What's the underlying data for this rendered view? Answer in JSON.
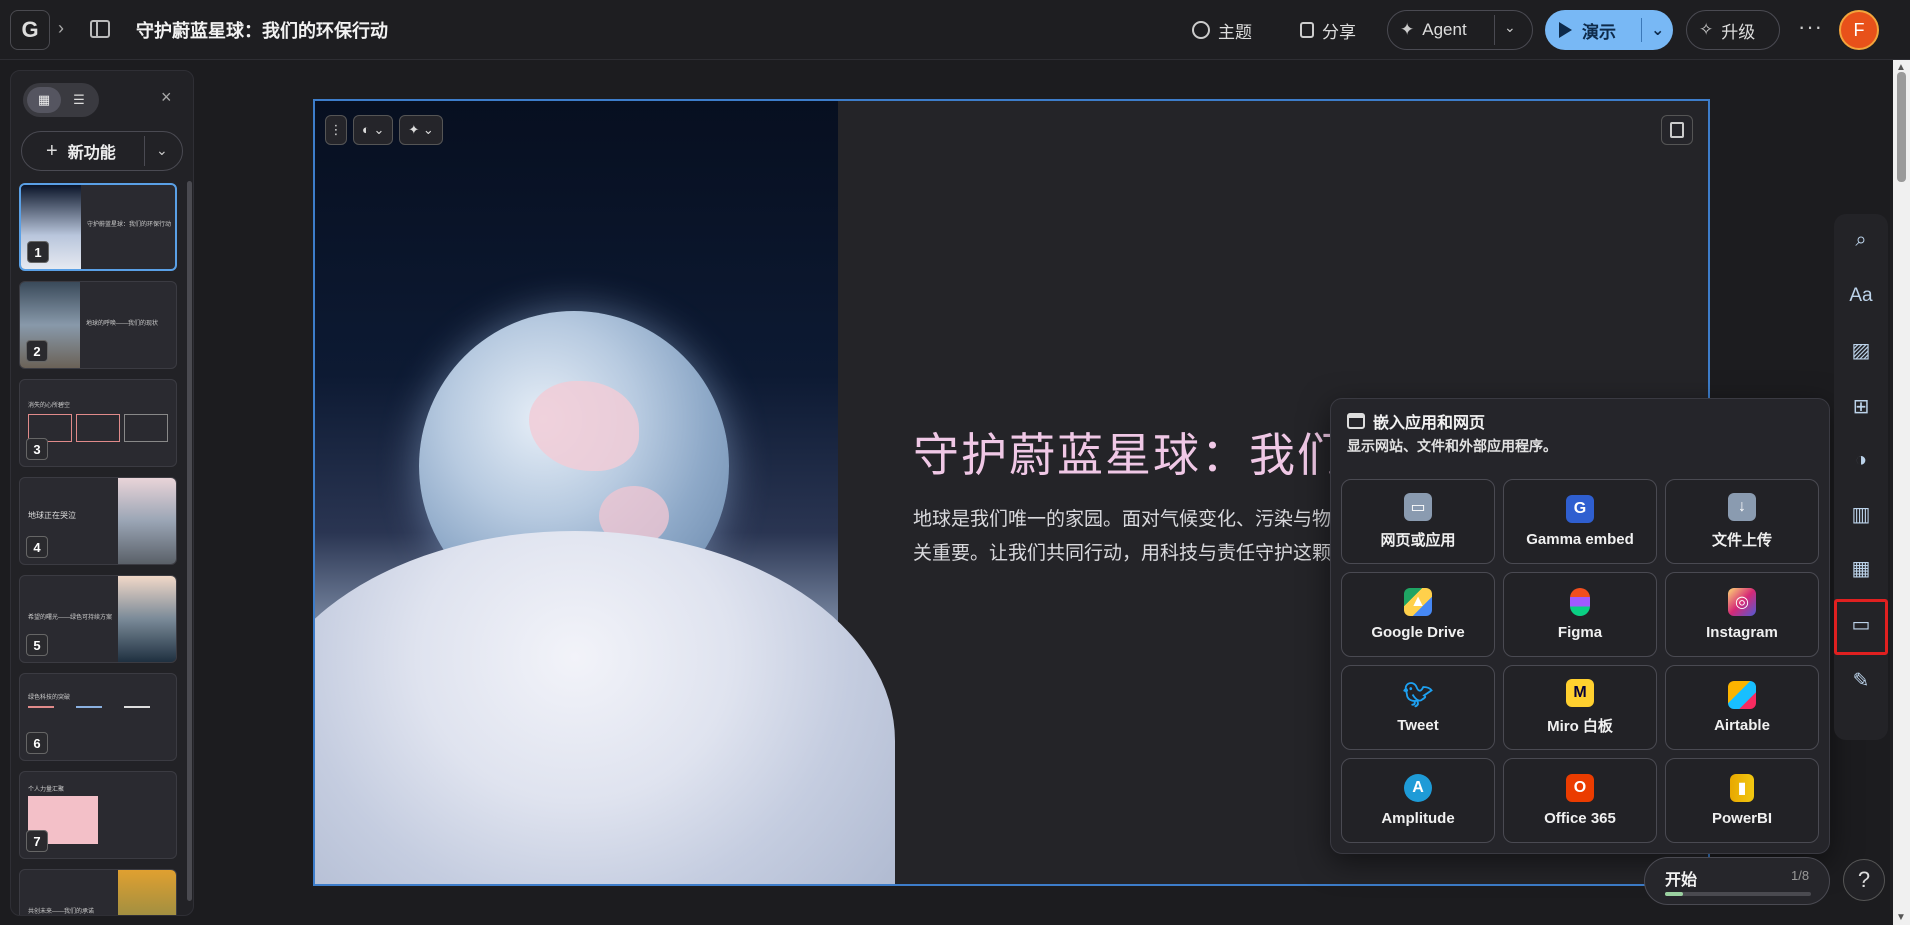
{
  "app": {
    "logo_letter": "G",
    "doc_title": "守护蔚蓝星球：我们的环保行动"
  },
  "toolbar": {
    "theme_label": "主题",
    "share_label": "分享",
    "agent_label": "Agent",
    "present_label": "演示",
    "upgrade_label": "升级",
    "more_label": "···",
    "avatar_letter": "F"
  },
  "left_panel": {
    "new_feature_label": "新功能",
    "close_label": "×",
    "thumbnails": [
      {
        "num": "1",
        "title": "守护蔚蓝星球：我们的环保行动"
      },
      {
        "num": "2",
        "title": "地球的呼唤——我们的现状"
      },
      {
        "num": "3",
        "title": "消失的心所碧空"
      },
      {
        "num": "4",
        "title": "地球正在哭泣"
      },
      {
        "num": "5",
        "title": "希望的曙光——绿色可持续方案"
      },
      {
        "num": "6",
        "title": "绿色科技的突破"
      },
      {
        "num": "7",
        "title": "个人力量汇聚"
      },
      {
        "num": "8",
        "title": "共创未来——我们的承诺"
      }
    ]
  },
  "slide": {
    "title_main": "守护蔚蓝星球：我们",
    "body": "地球是我们唯一的家园。面对气候变化、污染与物关重要。让我们共同行动，用科技与责任守护这颗"
  },
  "embed_popover": {
    "title": "嵌入应用和网页",
    "subtitle": "显示网站、文件和外部应用程序。",
    "items": [
      {
        "label": "网页或应用",
        "icon": "browser-window-icon",
        "color": "#8a9bb0"
      },
      {
        "label": "Gamma embed",
        "icon": "gamma-icon",
        "color": "#2f5fd0"
      },
      {
        "label": "文件上传",
        "icon": "file-upload-icon",
        "color": "#8a9bb0"
      },
      {
        "label": "Google Drive",
        "icon": "google-drive-icon",
        "color": "#1fa463"
      },
      {
        "label": "Figma",
        "icon": "figma-icon",
        "color": "#f24e1e"
      },
      {
        "label": "Instagram",
        "icon": "instagram-icon",
        "color": "#d6249f"
      },
      {
        "label": "Tweet",
        "icon": "twitter-bird-icon",
        "color": "#1da1f2"
      },
      {
        "label": "Miro 白板",
        "icon": "miro-icon",
        "color": "#ffd02f"
      },
      {
        "label": "Airtable",
        "icon": "airtable-icon",
        "color": "#18bfff"
      },
      {
        "label": "Amplitude",
        "icon": "amplitude-icon",
        "color": "#1e9bd7"
      },
      {
        "label": "Office 365",
        "icon": "office-icon",
        "color": "#eb3c00"
      },
      {
        "label": "PowerBI",
        "icon": "powerbi-icon",
        "color": "#f2c811"
      }
    ]
  },
  "start_widget": {
    "label": "开始",
    "counter": "1/8",
    "progress": 0.125
  },
  "help_label": "?"
}
